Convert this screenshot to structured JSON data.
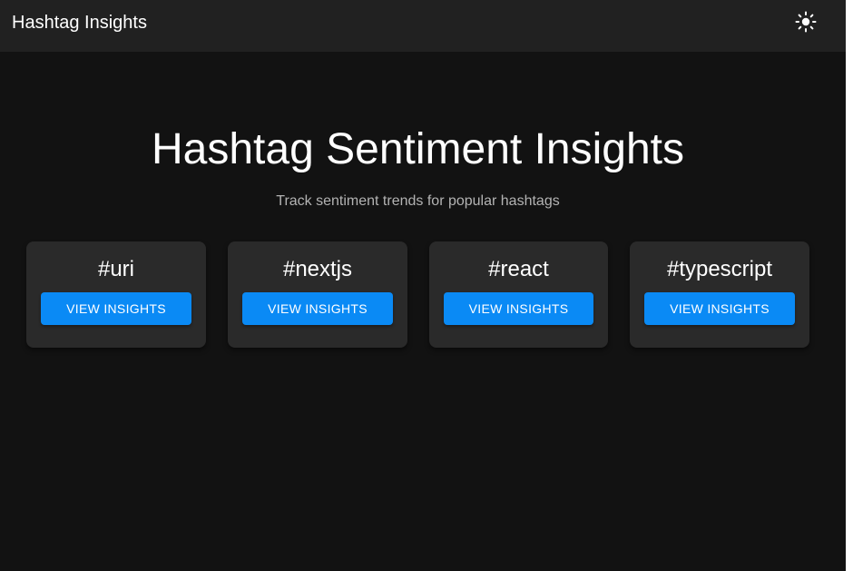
{
  "header": {
    "title": "Hashtag Insights",
    "theme_toggle_icon": "sun-icon"
  },
  "hero": {
    "title": "Hashtag Sentiment Insights",
    "subtitle": "Track sentiment trends for popular hashtags"
  },
  "cards": [
    {
      "tag": "#uri",
      "button_label": "VIEW INSIGHTS"
    },
    {
      "tag": "#nextjs",
      "button_label": "VIEW INSIGHTS"
    },
    {
      "tag": "#react",
      "button_label": "VIEW INSIGHTS"
    },
    {
      "tag": "#typescript",
      "button_label": "VIEW INSIGHTS"
    }
  ],
  "colors": {
    "background": "#121212",
    "appbar": "#212121",
    "card": "#2a2a2a",
    "accent": "#0a8af5",
    "subtitle": "#b3b3b3"
  }
}
